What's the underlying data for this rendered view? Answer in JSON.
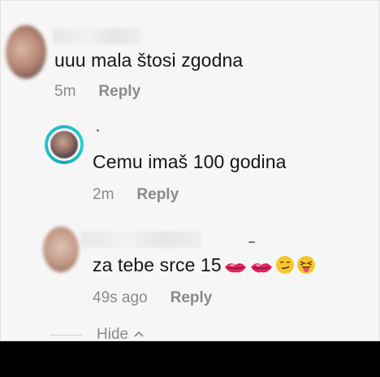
{
  "comments": [
    {
      "text": "uuu mala štosi zgodna",
      "time": "5m",
      "reply_label": "Reply"
    },
    {
      "text": "Cemu imaš 100 godina",
      "time": "2m",
      "reply_label": "Reply"
    },
    {
      "text": "za tebe srce 15",
      "time": "49s ago",
      "reply_label": "Reply",
      "emojis": [
        "kiss-lips-icon",
        "kiss-lips-icon",
        "smirk-face-icon",
        "tongue-face-icon"
      ]
    }
  ],
  "thread": {
    "hide_label": "Hide"
  },
  "colors": {
    "ring": "#1fb9c7",
    "meta_text": "#8a8a8a",
    "lips": "#e0245e"
  }
}
